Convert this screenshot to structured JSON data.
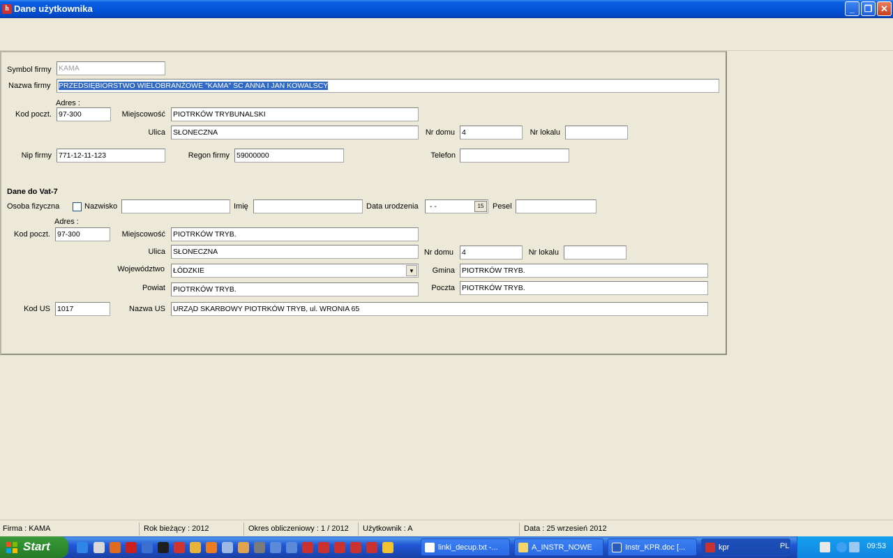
{
  "window": {
    "title": "Dane użytkownika",
    "minimize": "_",
    "restore": "❐",
    "close": "✕"
  },
  "firm": {
    "symbol_label": "Symbol firmy",
    "symbol_value": "KAMA",
    "name_label": "Nazwa firmy",
    "name_value": "PRZEDSIĘBIORSTWO WIELOBRANŻOWE \"KAMA\" SC ANNA I JAN KOWALSCY",
    "address_heading": "Adres :",
    "postal_label": "Kod poczt.",
    "postal_value": "97-300",
    "city_label": "Miejscowość",
    "city_value": "PIOTRKÓW TRYBUNALSKI",
    "street_label": "Ulica",
    "street_value": "SŁONECZNA",
    "house_label": "Nr domu",
    "house_value": "4",
    "flat_label": "Nr lokalu",
    "flat_value": "",
    "nip_label": "Nip firmy",
    "nip_value": "771-12-11-123",
    "regon_label": "Regon firmy",
    "regon_value": "59000000",
    "phone_label": "Telefon",
    "phone_value": ""
  },
  "vat": {
    "heading": "Dane do Vat-7",
    "person_label": "Osoba fizyczna",
    "person_checked": false,
    "surname_label": "Nazwisko",
    "surname_value": "",
    "firstname_label": "Imię",
    "firstname_value": "",
    "birthdate_label": "Data urodzenia",
    "birthdate_value": "-  -",
    "calendar_icon": "15",
    "pesel_label": "Pesel",
    "pesel_value": "",
    "address_heading": "Adres :",
    "postal_label": "Kod poczt.",
    "postal_value": "97-300",
    "city_label": "Miejscowość",
    "city_value": "PIOTRKÓW TRYB.",
    "street_label": "Ulica",
    "street_value": "SŁONECZNA",
    "house_label": "Nr domu",
    "house_value": "4",
    "flat_label": "Nr lokalu",
    "flat_value": "",
    "province_label": "Województwo",
    "province_value": "ŁÓDZKIE",
    "commune_label": "Gmina",
    "commune_value": "PIOTRKÓW TRYB.",
    "county_label": "Powiat",
    "county_value": "PIOTRKÓW TRYB.",
    "post_label": "Poczta",
    "post_value": "PIOTRKÓW TRYB.",
    "us_code_label": "Kod US",
    "us_code_value": "1017",
    "us_name_label": "Nazwa US",
    "us_name_value": "URZĄD SKARBOWY PIOTRKÓW TRYB, ul. WRONIA 65"
  },
  "status": {
    "firm": "Firma : KAMA",
    "year": "Rok bieżący : 2012",
    "period": "Okres obliczeniowy : 1 / 2012",
    "user": "Użytkownik : A",
    "date": "Data : 25 wrzesień 2012"
  },
  "taskbar": {
    "start": "Start",
    "tasks": [
      "linki_decup.txt -...",
      "A_INSTR_NOWE",
      "Instr_KPR.doc [...",
      "kpr"
    ],
    "lang": "PL",
    "clock": "09:53"
  },
  "colors": {
    "titlebar": "#0654d8",
    "selection": "#316ac5",
    "start_green": "#2e8b2e",
    "tray": "#0f86e0"
  }
}
